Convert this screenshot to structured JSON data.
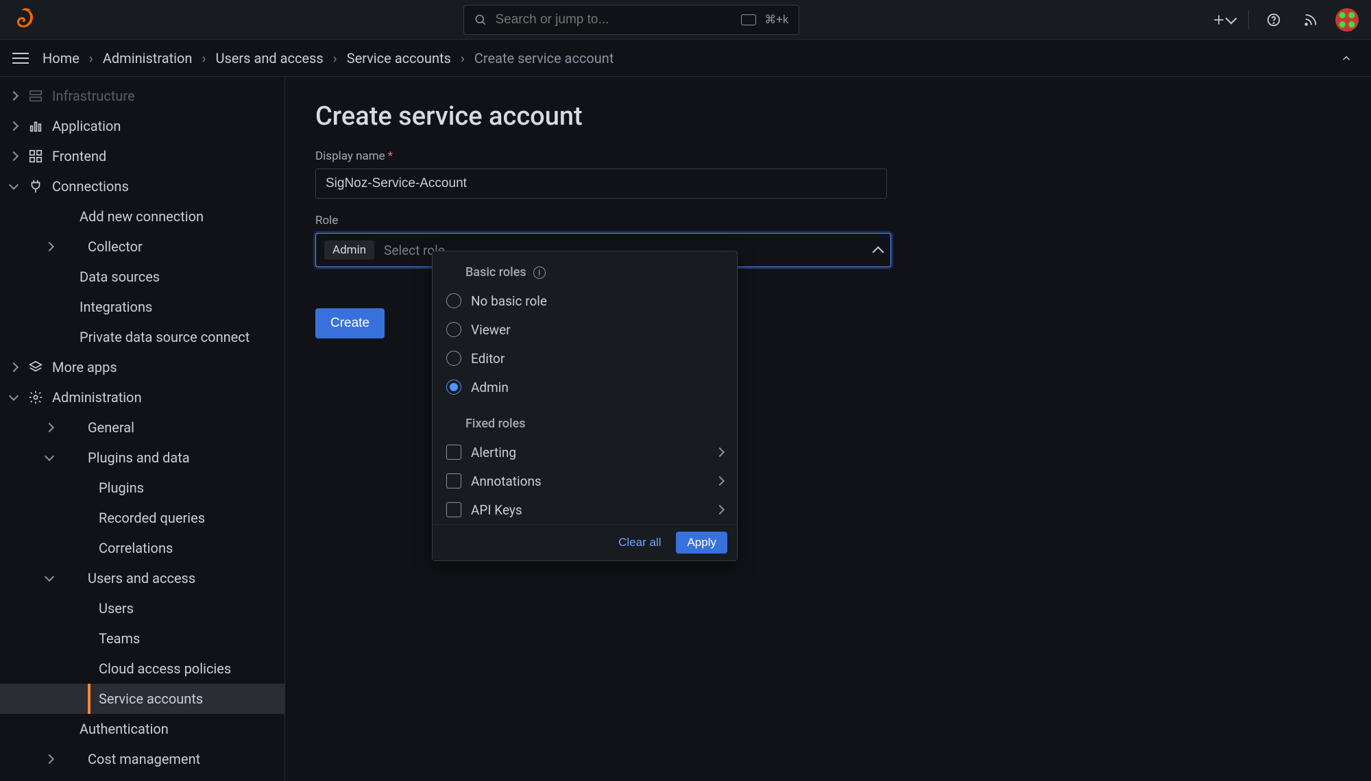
{
  "topbar": {
    "search_placeholder": "Search or jump to...",
    "kbd_hint": "⌘+k"
  },
  "breadcrumbs": {
    "items": [
      "Home",
      "Administration",
      "Users and access",
      "Service accounts"
    ],
    "current": "Create service account"
  },
  "sidebar": {
    "infrastructure": "Infrastructure",
    "application": "Application",
    "frontend": "Frontend",
    "connections": "Connections",
    "add_new_connection": "Add new connection",
    "collector": "Collector",
    "data_sources": "Data sources",
    "integrations": "Integrations",
    "private_ds_connect": "Private data source connect",
    "more_apps": "More apps",
    "administration": "Administration",
    "general": "General",
    "plugins_and_data": "Plugins and data",
    "plugins": "Plugins",
    "recorded_queries": "Recorded queries",
    "correlations": "Correlations",
    "users_and_access": "Users and access",
    "users": "Users",
    "teams": "Teams",
    "cloud_access_policies": "Cloud access policies",
    "service_accounts": "Service accounts",
    "authentication": "Authentication",
    "cost_management": "Cost management"
  },
  "main": {
    "title": "Create service account",
    "display_name_label": "Display name",
    "display_name_value": "SigNoz-Service-Account",
    "role_label": "Role",
    "role_chip": "Admin",
    "role_placeholder": "Select role",
    "create_button": "Create"
  },
  "dropdown": {
    "basic_roles_header": "Basic roles",
    "basic_roles": {
      "no_basic": "No basic role",
      "viewer": "Viewer",
      "editor": "Editor",
      "admin": "Admin"
    },
    "selected_basic": "admin",
    "fixed_roles_header": "Fixed roles",
    "fixed_roles": {
      "alerting": "Alerting",
      "annotations": "Annotations",
      "api_keys": "API Keys"
    },
    "clear_all": "Clear all",
    "apply": "Apply"
  },
  "colors": {
    "accent": "#3871dc",
    "active_indicator": "#ff8833"
  }
}
